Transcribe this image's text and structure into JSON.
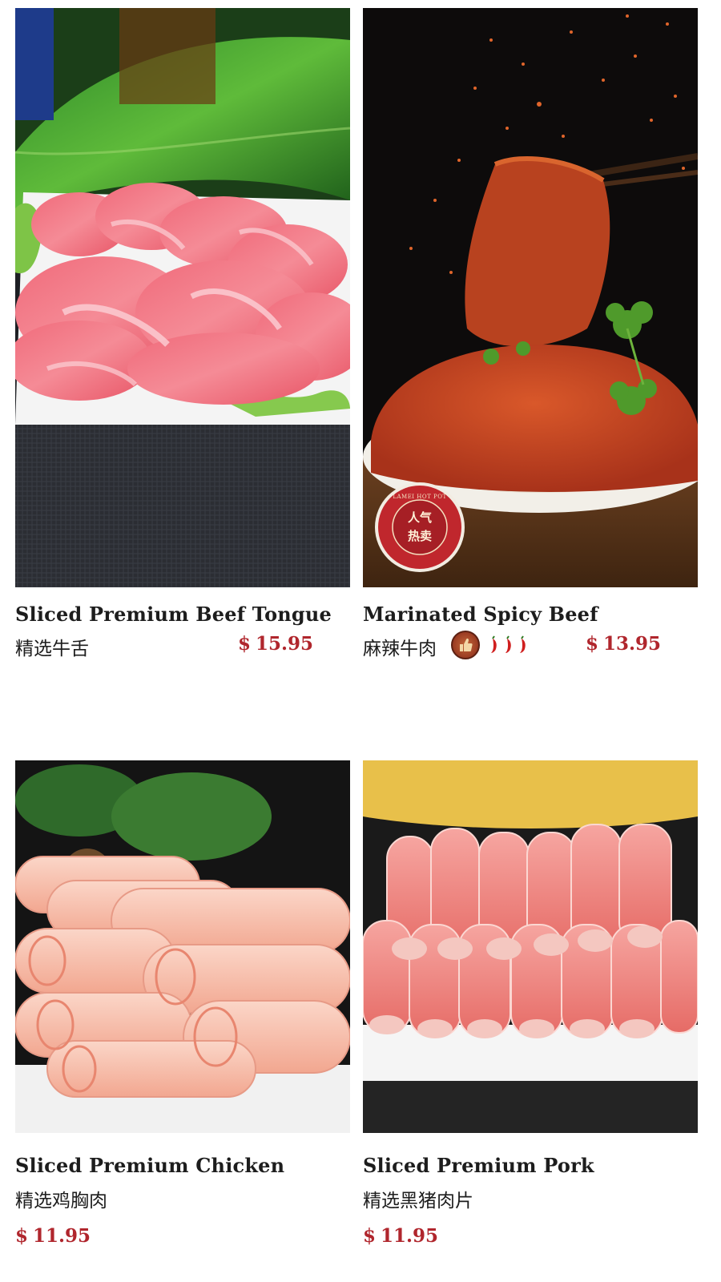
{
  "menu": {
    "items": [
      {
        "name_en": "Sliced Premium Beef Tongue",
        "name_zh": "精选牛舌",
        "currency": "$",
        "price": "15.95",
        "photo_icon": "beef-tongue-photo"
      },
      {
        "name_en": "Marinated Spicy Beef",
        "name_zh": "麻辣牛肉",
        "currency": "$",
        "price": "13.95",
        "photo_icon": "spicy-beef-photo",
        "stamp": {
          "ring_text": "LAMEI HOT POT",
          "line1": "人气",
          "line2": "热卖"
        },
        "badges": [
          "thumbs-up-icon",
          "chili-pepper-icon"
        ],
        "spice_level": 3
      },
      {
        "name_en": "Sliced Premium Chicken",
        "name_zh": "精选鸡胸肉",
        "currency": "$",
        "price": "11.95",
        "photo_icon": "chicken-rolls-photo"
      },
      {
        "name_en": "Sliced Premium Pork",
        "name_zh": "精选黑猪肉片",
        "currency": "$",
        "price": "11.95",
        "photo_icon": "pork-rolls-photo"
      }
    ]
  },
  "colors": {
    "price": "#b0262d",
    "text": "#1d1d1d",
    "background": "#ffffff"
  }
}
